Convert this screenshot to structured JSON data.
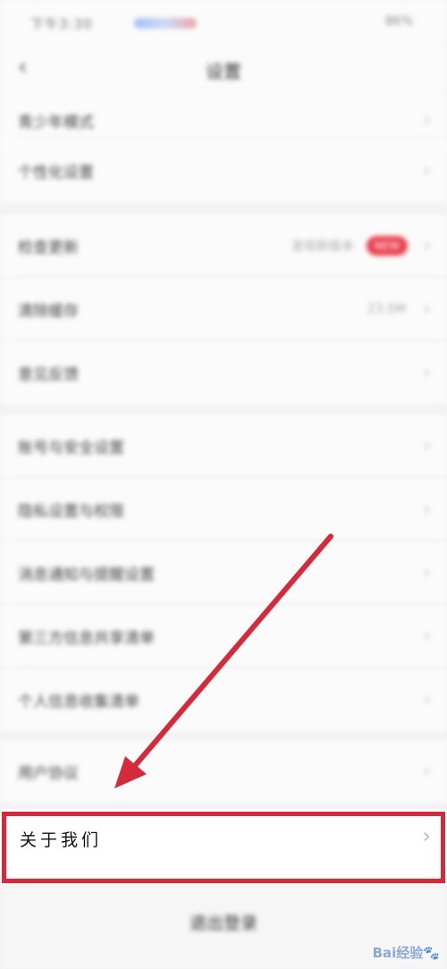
{
  "status_bar": {
    "time": "下午3:30",
    "battery": "86%"
  },
  "nav": {
    "back_icon": "chevron-left-icon",
    "title": "设置"
  },
  "rows": [
    {
      "label": "青少年模式",
      "value": "",
      "badge": ""
    },
    {
      "label": "个性化设置",
      "value": "",
      "badge": ""
    },
    {
      "label": "检查更新",
      "value": "发现新版本",
      "badge": "NEW"
    },
    {
      "label": "清除缓存",
      "value": "23.5M",
      "badge": ""
    },
    {
      "label": "意见反馈",
      "value": "",
      "badge": ""
    },
    {
      "label": "账号与安全设置",
      "value": "",
      "badge": ""
    },
    {
      "label": "隐私设置与权限",
      "value": "",
      "badge": ""
    },
    {
      "label": "消息通知与提醒设置",
      "value": "",
      "badge": ""
    },
    {
      "label": "第三方信息共享清单",
      "value": "",
      "badge": ""
    },
    {
      "label": "个人信息收集清单",
      "value": "",
      "badge": ""
    },
    {
      "label": "用户协议",
      "value": "",
      "badge": ""
    }
  ],
  "about": {
    "label": "关于我们"
  },
  "logout": {
    "label": "退出登录"
  },
  "watermark": {
    "text": "Bai经验",
    "paw": "🐾"
  },
  "colors": {
    "highlight": "#d52a3a",
    "badge": "#e8404d"
  }
}
